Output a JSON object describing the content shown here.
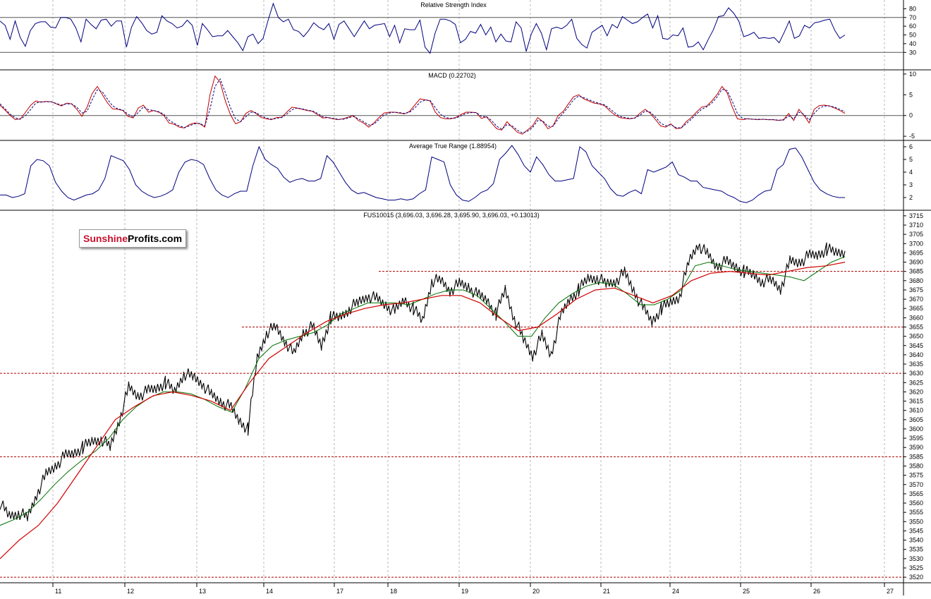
{
  "chart_data": [
    {
      "type": "line",
      "title": "Relative Strength Index",
      "ylim": [
        10,
        90
      ],
      "yticks": [
        30,
        40,
        50,
        60,
        70,
        80
      ],
      "reference_lines": [
        30,
        70
      ],
      "series": [
        {
          "values": [
            66,
            61,
            45,
            66,
            47,
            37,
            55,
            63,
            65,
            65,
            59,
            58,
            70,
            70,
            68,
            58,
            42,
            68,
            62,
            57,
            67,
            68,
            60,
            66,
            66,
            36,
            59,
            71,
            64,
            55,
            51,
            53,
            72,
            66,
            63,
            58,
            60,
            67,
            61,
            38,
            63,
            56,
            48,
            49,
            49,
            55,
            48,
            41,
            32,
            48,
            51,
            40,
            46,
            67,
            86,
            70,
            65,
            68,
            56,
            54,
            48,
            55,
            64,
            59,
            56,
            63,
            45,
            62,
            66,
            57,
            48,
            57,
            66,
            57,
            61,
            62,
            63,
            48,
            61,
            41,
            57,
            56,
            56,
            67,
            36,
            29,
            52,
            68,
            68,
            66,
            62,
            41,
            45,
            54,
            52,
            62,
            50,
            59,
            42,
            51,
            43,
            42,
            65,
            58,
            31,
            51,
            63,
            52,
            33,
            57,
            59,
            57,
            61,
            68,
            46,
            39,
            35,
            53,
            57,
            61,
            49,
            62,
            58,
            71,
            67,
            63,
            65,
            70,
            74,
            58,
            72,
            46,
            45,
            50,
            49,
            58,
            36,
            37,
            42,
            33,
            45,
            56,
            71,
            72,
            81,
            75,
            66,
            48,
            50,
            53,
            46,
            47,
            46,
            47,
            41,
            53,
            66,
            46,
            49,
            61,
            58,
            64,
            65,
            67,
            68,
            55,
            46,
            50
          ]
        }
      ]
    },
    {
      "type": "line",
      "title": "MACD (0.22702)",
      "ylim": [
        -6,
        11
      ],
      "yticks": [
        -5,
        0,
        5,
        10
      ],
      "reference_lines": [
        0
      ],
      "series": [
        {
          "values": [
            2.5,
            1.3,
            0.0,
            -1.0,
            -0.8,
            0.8,
            2.5,
            3.5,
            3.2,
            3.4,
            3.3,
            2.8,
            2.3,
            3.0,
            2.8,
            1.5,
            -0.2,
            2.0,
            5.3,
            7.0,
            5.0,
            3.0,
            1.6,
            1.5,
            1.2,
            -0.2,
            -0.6,
            1.8,
            2.5,
            0.8,
            1.2,
            0.8,
            0.0,
            -1.8,
            -2.1,
            -2.8,
            -3.0,
            -2.2,
            -1.8,
            -2.0,
            -2.8,
            5.0,
            9.5,
            8.0,
            3.5,
            0.2,
            -2.0,
            -1.5,
            0.5,
            1.2,
            0.5,
            -0.5,
            -0.8,
            -1.0,
            -0.5,
            -0.4,
            0.8,
            2.0,
            1.8,
            1.5,
            1.2,
            1.0,
            0.2,
            -0.6,
            -0.5,
            -0.8,
            -1.0,
            -0.8,
            -0.4,
            0.0,
            -1.2,
            -1.8,
            -2.8,
            -1.8,
            -0.5,
            0.6,
            0.8,
            0.8,
            0.6,
            0.4,
            1.0,
            2.5,
            4.0,
            3.8,
            3.5,
            0.8,
            -0.5,
            -0.8,
            -0.8,
            -0.5,
            0.2,
            0.8,
            0.8,
            0.7,
            -0.7,
            -0.3,
            -1.8,
            -3.2,
            -3.5,
            -1.5,
            -2.8,
            -4.0,
            -4.5,
            -3.5,
            -2.5,
            -0.5,
            -1.5,
            -3.2,
            -2.5,
            0.0,
            1.0,
            2.8,
            4.5,
            5.0,
            4.0,
            3.5,
            3.0,
            2.8,
            2.4,
            1.2,
            0.2,
            -0.5,
            -0.7,
            -0.8,
            -0.6,
            0.6,
            1.5,
            0.5,
            -1.0,
            -2.5,
            -2.8,
            -2.0,
            -3.2,
            -3.0,
            -1.5,
            -0.5,
            0.8,
            2.0,
            2.3,
            3.5,
            5.0,
            7.0,
            5.5,
            2.0,
            -0.8,
            -1.0,
            -0.8,
            -0.9,
            -1.0,
            -0.9,
            -1.0,
            -1.0,
            -1.2,
            -1.0,
            0.5,
            -1.2,
            1.5,
            0.0,
            -1.8,
            1.5,
            2.4,
            2.5,
            2.3,
            1.8,
            1.2,
            0.5
          ]
        },
        {
          "values": [
            2.8,
            1.6,
            0.3,
            -0.6,
            -0.9,
            0.0,
            1.5,
            3.0,
            3.3,
            3.3,
            3.3,
            2.9,
            2.5,
            2.8,
            2.8,
            2.0,
            0.6,
            1.0,
            3.8,
            6.2,
            5.7,
            3.9,
            2.3,
            1.6,
            1.3,
            0.3,
            -0.4,
            0.7,
            2.1,
            1.4,
            1.2,
            0.9,
            0.3,
            -1.1,
            -1.9,
            -2.5,
            -2.9,
            -2.5,
            -2.0,
            -1.9,
            -2.5,
            1.5,
            7.0,
            8.8,
            5.5,
            1.9,
            -0.8,
            -1.5,
            -0.3,
            0.8,
            0.7,
            -0.1,
            -0.6,
            -0.9,
            -0.7,
            -0.5,
            0.3,
            1.4,
            1.8,
            1.6,
            1.3,
            1.1,
            0.5,
            -0.3,
            -0.5,
            -0.7,
            -0.9,
            -0.9,
            -0.6,
            -0.2,
            -0.8,
            -1.5,
            -2.3,
            -2.1,
            -1.0,
            0.1,
            0.6,
            0.8,
            0.7,
            0.5,
            0.8,
            1.8,
            3.2,
            3.7,
            3.6,
            1.9,
            0.3,
            -0.5,
            -0.7,
            -0.6,
            -0.1,
            0.5,
            0.7,
            0.7,
            -0.2,
            -0.3,
            -1.2,
            -2.6,
            -3.3,
            -2.2,
            -2.5,
            -3.5,
            -4.2,
            -3.8,
            -2.9,
            -1.2,
            -1.3,
            -2.6,
            -2.6,
            -0.8,
            0.6,
            2.1,
            3.8,
            4.7,
            4.3,
            3.8,
            3.3,
            2.9,
            2.6,
            1.7,
            0.7,
            -0.2,
            -0.5,
            -0.7,
            -0.6,
            0.1,
            1.1,
            0.8,
            -0.4,
            -1.8,
            -2.5,
            -2.2,
            -2.9,
            -3.0,
            -2.0,
            -0.9,
            0.3,
            1.5,
            2.1,
            3.0,
            4.4,
            6.3,
            6.0,
            3.4,
            0.5,
            -0.7,
            -0.8,
            -0.9,
            -0.9,
            -0.9,
            -1.0,
            -1.0,
            -1.1,
            -1.1,
            -0.1,
            -0.8,
            0.8,
            0.3,
            -1.1,
            0.5,
            1.8,
            2.3,
            2.3,
            2.0,
            1.5,
            0.9
          ]
        }
      ]
    },
    {
      "type": "line",
      "title": "Average True Range (1.88954)",
      "ylim": [
        1,
        6.5
      ],
      "yticks": [
        2,
        3,
        4,
        5,
        6
      ],
      "series": [
        {
          "values": [
            2.2,
            2.2,
            2.0,
            2.1,
            2.3,
            4.5,
            5.0,
            4.9,
            4.5,
            3.2,
            2.5,
            2.0,
            1.8,
            2.0,
            2.2,
            2.3,
            2.6,
            3.5,
            5.3,
            5.1,
            4.9,
            4.2,
            3.0,
            2.5,
            2.2,
            2.0,
            2.1,
            2.3,
            2.6,
            4.0,
            4.8,
            5.0,
            4.9,
            4.6,
            3.5,
            2.6,
            2.2,
            2.0,
            2.3,
            2.5,
            2.5,
            4.5,
            6.0,
            5.0,
            4.6,
            4.3,
            3.6,
            3.2,
            3.4,
            3.5,
            3.3,
            3.3,
            3.5,
            5.3,
            4.8,
            4.0,
            3.2,
            2.6,
            2.3,
            2.4,
            2.2,
            2.0,
            1.9,
            1.8,
            1.8,
            1.9,
            1.8,
            1.9,
            2.3,
            2.6,
            5.2,
            5.0,
            4.8,
            3.0,
            2.2,
            1.8,
            1.7,
            2.0,
            2.4,
            2.6,
            3.1,
            5.0,
            5.5,
            6.1,
            5.4,
            4.5,
            4.0,
            5.2,
            4.6,
            3.8,
            3.3,
            3.3,
            3.4,
            3.5,
            6.0,
            5.6,
            4.5,
            4.0,
            3.5,
            2.7,
            2.2,
            2.1,
            2.4,
            2.6,
            2.3,
            4.2,
            4.0,
            4.2,
            4.4,
            4.8,
            3.8,
            3.6,
            3.3,
            3.3,
            2.8,
            2.7,
            2.6,
            2.5,
            2.2,
            2.0,
            1.7,
            1.6,
            1.8,
            2.2,
            2.5,
            2.6,
            4.2,
            4.6,
            5.8,
            5.9,
            5.2,
            4.2,
            3.2,
            2.6,
            2.3,
            2.1,
            2.0,
            2.0
          ]
        }
      ]
    },
    {
      "type": "line",
      "title": "FUS10015 (3,696.03, 3,696.28, 3,695.90, 3,696.03, +0.13013)",
      "ylim": [
        3517,
        3718
      ],
      "yticks": [
        3520,
        3525,
        3530,
        3535,
        3540,
        3545,
        3550,
        3555,
        3560,
        3565,
        3570,
        3575,
        3580,
        3585,
        3590,
        3595,
        3600,
        3605,
        3610,
        3615,
        3620,
        3625,
        3630,
        3635,
        3640,
        3645,
        3650,
        3655,
        3660,
        3665,
        3670,
        3675,
        3680,
        3685,
        3690,
        3695,
        3700,
        3705,
        3710,
        3715
      ],
      "x_tick_labels": [
        "11",
        "12",
        "13",
        "14",
        "17",
        "18",
        "19",
        "20",
        "21",
        "24",
        "25",
        "26",
        "27"
      ],
      "horizontal_levels": [
        3685,
        3655,
        3630,
        3585,
        3520
      ],
      "series": [
        {
          "name": "price",
          "values": [
            3560,
            3553,
            3555,
            3552,
            3565,
            3575,
            3580,
            3585,
            3587,
            3590,
            3593,
            3595,
            3590,
            3605,
            3622,
            3618,
            3620,
            3622,
            3625,
            3620,
            3630,
            3628,
            3625,
            3618,
            3615,
            3612,
            3605,
            3600,
            3638,
            3652,
            3655,
            3648,
            3640,
            3652,
            3655,
            3645,
            3660,
            3660,
            3665,
            3668,
            3672,
            3670,
            3667,
            3663,
            3670,
            3665,
            3658,
            3680,
            3680,
            3675,
            3678,
            3677,
            3672,
            3670,
            3662,
            3675,
            3660,
            3648,
            3640,
            3650,
            3640,
            3660,
            3670,
            3675,
            3681,
            3682,
            3678,
            3680,
            3684,
            3675,
            3665,
            3658,
            3665,
            3668,
            3672,
            3690,
            3700,
            3694,
            3688,
            3690,
            3688,
            3685,
            3683,
            3680,
            3680,
            3676,
            3690,
            3690,
            3693,
            3694,
            3697,
            3695,
            3696
          ]
        },
        {
          "name": "green",
          "values": [
            3548,
            3551,
            3555,
            3562,
            3570,
            3577,
            3583,
            3588,
            3595,
            3605,
            3612,
            3617,
            3620,
            3620,
            3619,
            3616,
            3612,
            3609,
            3622,
            3638,
            3645,
            3648,
            3650,
            3652,
            3656,
            3662,
            3665,
            3668,
            3668,
            3668,
            3667,
            3670,
            3673,
            3675,
            3675,
            3672,
            3665,
            3658,
            3650,
            3650,
            3660,
            3668,
            3673,
            3677,
            3679,
            3678,
            3673,
            3667,
            3667,
            3670,
            3675,
            3688,
            3690,
            3688,
            3686,
            3685,
            3684,
            3683,
            3682,
            3680,
            3685,
            3690,
            3693
          ]
        },
        {
          "name": "red",
          "values": [
            3530,
            3540,
            3548,
            3560,
            3575,
            3590,
            3605,
            3612,
            3618,
            3620,
            3618,
            3615,
            3610,
            3625,
            3638,
            3645,
            3652,
            3658,
            3662,
            3665,
            3667,
            3668,
            3670,
            3672,
            3672,
            3668,
            3660,
            3653,
            3655,
            3662,
            3670,
            3675,
            3676,
            3672,
            3668,
            3672,
            3680,
            3684,
            3685,
            3684,
            3683,
            3685,
            3687,
            3688,
            3690
          ]
        }
      ]
    }
  ],
  "logo": {
    "part1": "Sunshine",
    "part2": "Profits.com"
  }
}
